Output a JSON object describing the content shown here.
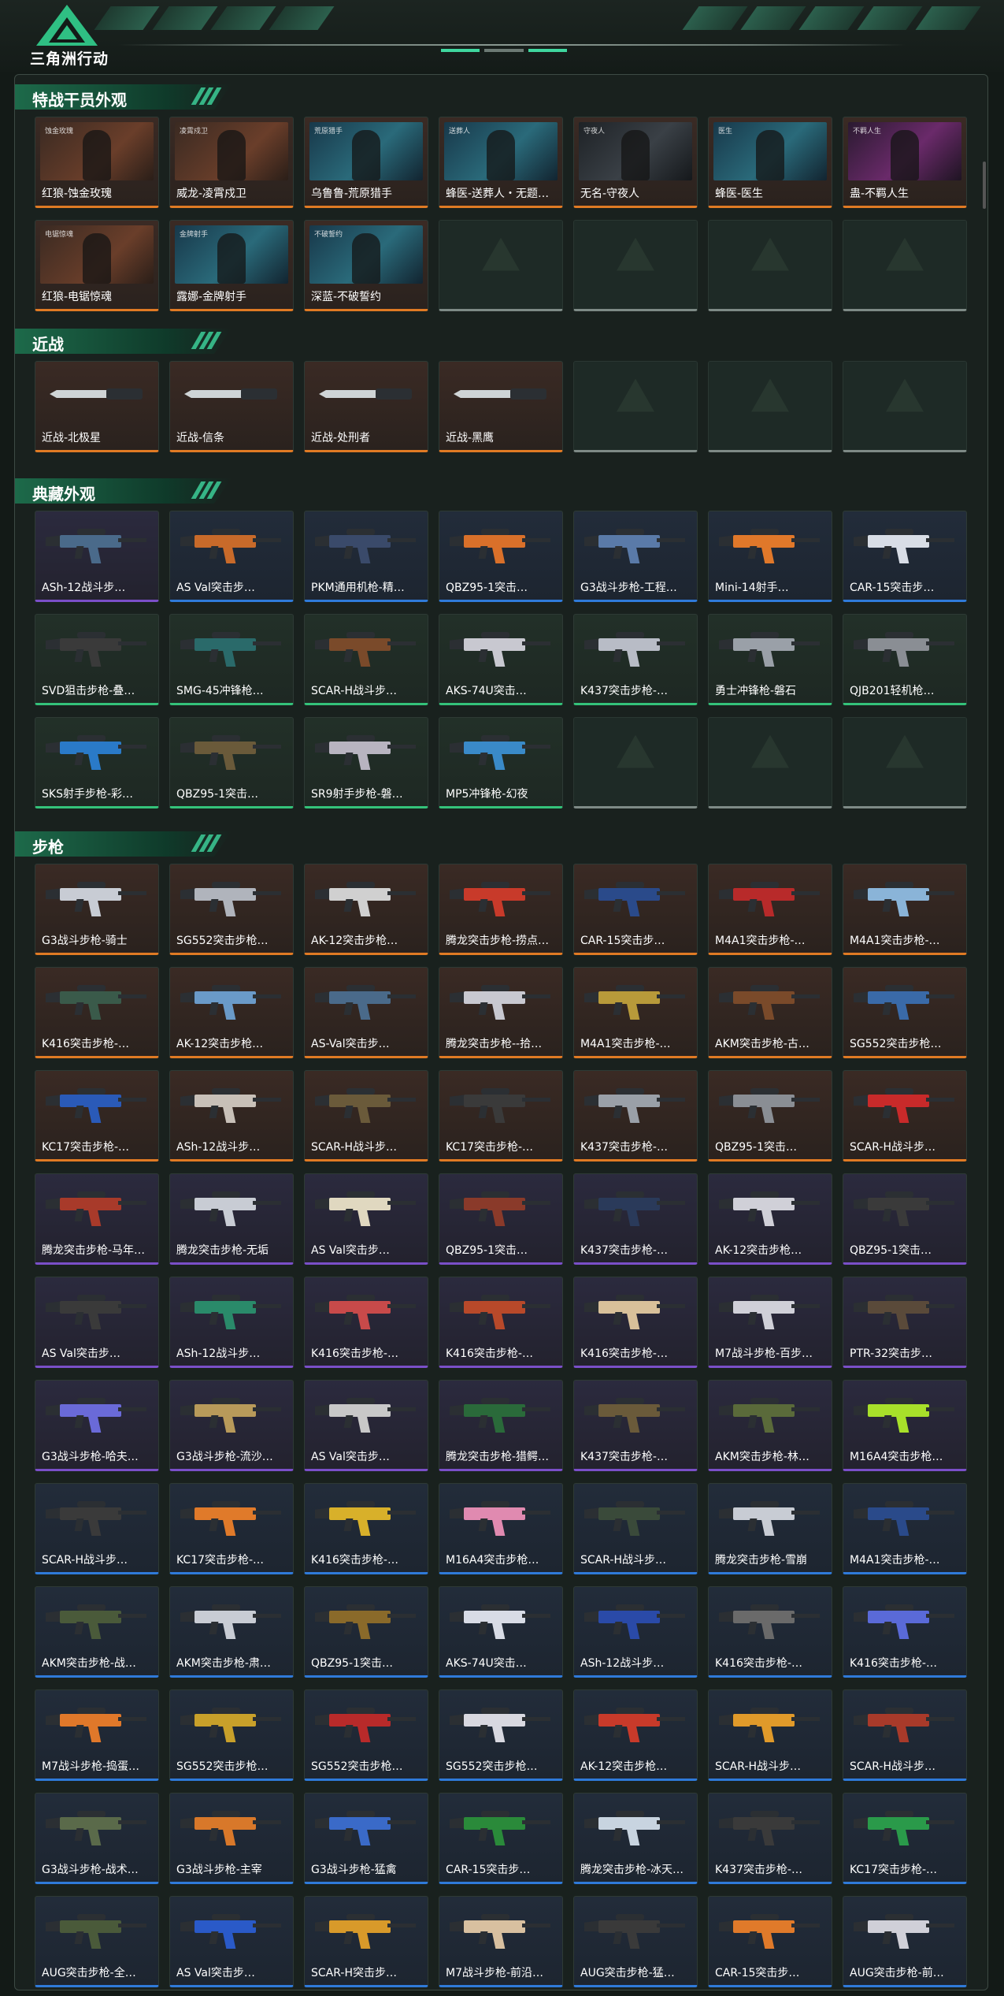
{
  "header": {
    "logo_text": "三角洲行动"
  },
  "sections": [
    {
      "title": "特战干员外观",
      "cards": [
        {
          "label": "红狼-蚀金玫瑰",
          "rarity": "orange",
          "tag": "蚀金玫瑰",
          "photo": "warm"
        },
        {
          "label": "威龙-凌霄戍卫",
          "rarity": "orange",
          "tag": "凌霄戍卫",
          "photo": "warm"
        },
        {
          "label": "乌鲁鲁-荒原猎手",
          "rarity": "orange",
          "tag": "荒原猎手",
          "photo": "teal"
        },
        {
          "label": "蜂医-送葬人・无题…",
          "rarity": "orange",
          "tag": "送葬人",
          "photo": "teal"
        },
        {
          "label": "无名-守夜人",
          "rarity": "orange",
          "tag": "守夜人",
          "photo": "dark"
        },
        {
          "label": "蜂医-医生",
          "rarity": "orange",
          "tag": "医生",
          "photo": "teal"
        },
        {
          "label": "蛊-不羁人生",
          "rarity": "orange",
          "tag": "不羁人生",
          "photo": "magenta"
        },
        {
          "label": "红狼-电锯惊魂",
          "rarity": "orange",
          "tag": "电锯惊魂",
          "photo": "warm"
        },
        {
          "label": "露娜-金牌射手",
          "rarity": "orange",
          "tag": "金牌射手",
          "photo": "teal"
        },
        {
          "label": "深蓝-不破誓约",
          "rarity": "orange",
          "tag": "不破誓约",
          "photo": "teal"
        },
        {
          "empty": true
        },
        {
          "empty": true
        },
        {
          "empty": true
        },
        {
          "empty": true
        }
      ]
    },
    {
      "title": "近战",
      "cards": [
        {
          "label": "近战-北极星",
          "rarity": "orange",
          "melee": true
        },
        {
          "label": "近战-信条",
          "rarity": "orange",
          "melee": true
        },
        {
          "label": "近战-处刑者",
          "rarity": "orange",
          "melee": true
        },
        {
          "label": "近战-黑鹰",
          "rarity": "orange",
          "melee": true
        },
        {
          "empty": true
        },
        {
          "empty": true
        },
        {
          "empty": true
        }
      ]
    },
    {
      "title": "典藏外观",
      "cards": [
        {
          "label": "ASh-12战斗步…",
          "rarity": "purple",
          "color": "#4a6a8a"
        },
        {
          "label": "AS Val突击步…",
          "rarity": "blue",
          "color": "#c86a2a"
        },
        {
          "label": "PKM通用机枪-精…",
          "rarity": "blue",
          "color": "#3a4a6a"
        },
        {
          "label": "QBZ95-1突击…",
          "rarity": "blue",
          "color": "#d9702a"
        },
        {
          "label": "G3战斗步枪-工程…",
          "rarity": "blue",
          "color": "#5a7aa8"
        },
        {
          "label": "Mini-14射手…",
          "rarity": "blue",
          "color": "#e0782a"
        },
        {
          "label": "CAR-15突击步…",
          "rarity": "blue",
          "color": "#d8dde6"
        },
        {
          "label": "SVD狙击步枪-叠…",
          "rarity": "green",
          "color": "#3a3a3a"
        },
        {
          "label": "SMG-45冲锋枪…",
          "rarity": "green",
          "color": "#2a6a6a"
        },
        {
          "label": "SCAR-H战斗步…",
          "rarity": "green",
          "color": "#7a4a2a"
        },
        {
          "label": "AKS-74U突击…",
          "rarity": "green",
          "color": "#c8c8d0"
        },
        {
          "label": "K437突击步枪-…",
          "rarity": "green",
          "color": "#b8bcc6"
        },
        {
          "label": "勇士冲锋枪-磐石",
          "rarity": "green",
          "color": "#9aa0a8"
        },
        {
          "label": "QJB201轻机枪…",
          "rarity": "green",
          "color": "#8a8e94"
        },
        {
          "label": "SKS射手步枪-彩…",
          "rarity": "green",
          "color": "#2a7ac8"
        },
        {
          "label": "QBZ95-1突击…",
          "rarity": "green",
          "color": "#6a5a3a"
        },
        {
          "label": "SR9射手步枪-磐…",
          "rarity": "green",
          "color": "#b8b4c0"
        },
        {
          "label": "MP5冲锋枪-幻夜",
          "rarity": "green",
          "color": "#3a8ac8"
        },
        {
          "empty": true
        },
        {
          "empty": true
        },
        {
          "empty": true
        }
      ]
    },
    {
      "title": "步枪",
      "cards": [
        {
          "label": "G3战斗步枪-骑士",
          "rarity": "orange",
          "color": "#c8ccd4"
        },
        {
          "label": "SG552突击步枪…",
          "rarity": "orange",
          "color": "#b0b4bc"
        },
        {
          "label": "AK-12突击步枪…",
          "rarity": "orange",
          "color": "#d0d0d0"
        },
        {
          "label": "腾龙突击步枪-捞点…",
          "rarity": "orange",
          "color": "#c83a2a"
        },
        {
          "label": "CAR-15突击步…",
          "rarity": "orange",
          "color": "#2a4a8a"
        },
        {
          "label": "M4A1突击步枪-…",
          "rarity": "orange",
          "color": "#b82a2a"
        },
        {
          "label": "M4A1突击步枪-…",
          "rarity": "orange",
          "color": "#8ab4d8"
        },
        {
          "label": "K416突击步枪-…",
          "rarity": "orange",
          "color": "#3a5a4a"
        },
        {
          "label": "AK-12突击步枪…",
          "rarity": "orange",
          "color": "#6a9ac8"
        },
        {
          "label": "AS-Val突击步…",
          "rarity": "orange",
          "color": "#4a6a8a"
        },
        {
          "label": "腾龙突击步枪--拾…",
          "rarity": "orange",
          "color": "#c8c8d0"
        },
        {
          "label": "M4A1突击步枪-…",
          "rarity": "orange",
          "color": "#b89a3a"
        },
        {
          "label": "AKM突击步枪-古…",
          "rarity": "orange",
          "color": "#7a4a2a"
        },
        {
          "label": "SG552突击步枪…",
          "rarity": "orange",
          "color": "#3a6aa8"
        },
        {
          "label": "KC17突击步枪-…",
          "rarity": "orange",
          "color": "#2a5ab8"
        },
        {
          "label": "ASh-12战斗步…",
          "rarity": "orange",
          "color": "#c8c0b8"
        },
        {
          "label": "SCAR-H战斗步…",
          "rarity": "orange",
          "color": "#6a5a3a"
        },
        {
          "label": "KC17突击步枪-…",
          "rarity": "orange",
          "color": "#3a3a3a"
        },
        {
          "label": "K437突击步枪-…",
          "rarity": "orange",
          "color": "#9aa0a8"
        },
        {
          "label": "QBZ95-1突击…",
          "rarity": "orange",
          "color": "#8a8e94"
        },
        {
          "label": "SCAR-H战斗步…",
          "rarity": "orange",
          "color": "#c82a2a"
        },
        {
          "label": "腾龙突击步枪-马年…",
          "rarity": "purple",
          "color": "#a83a2a"
        },
        {
          "label": "腾龙突击步枪-无垢",
          "rarity": "purple",
          "color": "#c8ccd4"
        },
        {
          "label": "AS Val突击步…",
          "rarity": "purple",
          "color": "#e0d8c0"
        },
        {
          "label": "QBZ95-1突击…",
          "rarity": "purple",
          "color": "#8a3a2a"
        },
        {
          "label": "K437突击步枪-…",
          "rarity": "purple",
          "color": "#2a3a5a"
        },
        {
          "label": "AK-12突击步枪…",
          "rarity": "purple",
          "color": "#d0d0d8"
        },
        {
          "label": "QBZ95-1突击…",
          "rarity": "purple",
          "color": "#3a3a3a"
        },
        {
          "label": "AS Val突击步…",
          "rarity": "purple",
          "color": "#3a3a3a"
        },
        {
          "label": "ASh-12战斗步…",
          "rarity": "purple",
          "color": "#2a8a6a"
        },
        {
          "label": "K416突击步枪-…",
          "rarity": "purple",
          "color": "#c84a4a"
        },
        {
          "label": "K416突击步枪-…",
          "rarity": "purple",
          "color": "#b8492a"
        },
        {
          "label": "K416突击步枪-…",
          "rarity": "purple",
          "color": "#d8c09a"
        },
        {
          "label": "M7战斗步枪-百步…",
          "rarity": "purple",
          "color": "#d0d0d8"
        },
        {
          "label": "PTR-32突击步…",
          "rarity": "purple",
          "color": "#5a4a3a"
        },
        {
          "label": "G3战斗步枪-哈夫…",
          "rarity": "purple",
          "color": "#6a6ad8"
        },
        {
          "label": "G3战斗步枪-流沙…",
          "rarity": "purple",
          "color": "#b89a5a"
        },
        {
          "label": "AS Val突击步…",
          "rarity": "purple",
          "color": "#c8c8c8"
        },
        {
          "label": "腾龙突击步枪-猎鳄…",
          "rarity": "purple",
          "color": "#2a6a3a"
        },
        {
          "label": "K437突击步枪-…",
          "rarity": "purple",
          "color": "#6a5a3a"
        },
        {
          "label": "AKM突击步枪-林…",
          "rarity": "purple",
          "color": "#5a6a3a"
        },
        {
          "label": "M16A4突击步枪…",
          "rarity": "purple",
          "color": "#a8e02a"
        },
        {
          "label": "SCAR-H战斗步…",
          "rarity": "blue",
          "color": "#3a3a3a"
        },
        {
          "label": "KC17突击步枪-…",
          "rarity": "blue",
          "color": "#e07a2a"
        },
        {
          "label": "K416突击步枪-…",
          "rarity": "blue",
          "color": "#d8b02a"
        },
        {
          "label": "M16A4突击步枪…",
          "rarity": "blue",
          "color": "#e08ab0"
        },
        {
          "label": "SCAR-H战斗步…",
          "rarity": "blue",
          "color": "#3a4a3a"
        },
        {
          "label": "腾龙突击步枪-雪崩",
          "rarity": "blue",
          "color": "#c8ccd4"
        },
        {
          "label": "M4A1突击步枪-…",
          "rarity": "blue",
          "color": "#2a4a8a"
        },
        {
          "label": "AKM突击步枪-战…",
          "rarity": "blue",
          "color": "#4a5a3a"
        },
        {
          "label": "AKM突击步枪-肃…",
          "rarity": "blue",
          "color": "#c8ccd4"
        },
        {
          "label": "QBZ95-1突击…",
          "rarity": "blue",
          "color": "#8a6a2a"
        },
        {
          "label": "AKS-74U突击…",
          "rarity": "blue",
          "color": "#d8dce6"
        },
        {
          "label": "ASh-12战斗步…",
          "rarity": "blue",
          "color": "#2a4aa8"
        },
        {
          "label": "K416突击步枪-…",
          "rarity": "blue",
          "color": "#6a6a6a"
        },
        {
          "label": "K416突击步枪-…",
          "rarity": "blue",
          "color": "#5a6ad8"
        },
        {
          "label": "M7战斗步枪-捣蛋…",
          "rarity": "blue",
          "color": "#e0782a"
        },
        {
          "label": "SG552突击步枪…",
          "rarity": "blue",
          "color": "#c8a02a"
        },
        {
          "label": "SG552突击步枪…",
          "rarity": "blue",
          "color": "#b82a2a"
        },
        {
          "label": "SG552突击步枪…",
          "rarity": "blue",
          "color": "#d8d8e0"
        },
        {
          "label": "AK-12突击步枪…",
          "rarity": "blue",
          "color": "#c83a2a"
        },
        {
          "label": "SCAR-H战斗步…",
          "rarity": "blue",
          "color": "#e09a2a"
        },
        {
          "label": "SCAR-H战斗步…",
          "rarity": "blue",
          "color": "#a83a2a"
        },
        {
          "label": "G3战斗步枪-战术…",
          "rarity": "blue",
          "color": "#5a6a4a"
        },
        {
          "label": "G3战斗步枪-主宰",
          "rarity": "blue",
          "color": "#d8782a"
        },
        {
          "label": "G3战斗步枪-猛禽",
          "rarity": "blue",
          "color": "#3a6ac8"
        },
        {
          "label": "CAR-15突击步…",
          "rarity": "blue",
          "color": "#2a8a3a"
        },
        {
          "label": "腾龙突击步枪-冰天…",
          "rarity": "blue",
          "color": "#c8d4e0"
        },
        {
          "label": "K437突击步枪-…",
          "rarity": "blue",
          "color": "#3a3a3a"
        },
        {
          "label": "KC17突击步枪-…",
          "rarity": "blue",
          "color": "#2a9a4a"
        },
        {
          "label": "AUG突击步枪-全…",
          "rarity": "blue",
          "color": "#4a5a3a"
        },
        {
          "label": "AS Val突击步…",
          "rarity": "blue",
          "color": "#2a5ac8"
        },
        {
          "label": "SCAR-H突击步…",
          "rarity": "blue",
          "color": "#d89a2a"
        },
        {
          "label": "M7战斗步枪-前沿…",
          "rarity": "blue",
          "color": "#d8c0a0"
        },
        {
          "label": "AUG突击步枪-猛…",
          "rarity": "blue",
          "color": "#3a3a3a"
        },
        {
          "label": "CAR-15突击步…",
          "rarity": "blue",
          "color": "#e07a2a"
        },
        {
          "label": "AUG突击步枪-前…",
          "rarity": "blue",
          "color": "#d0d0d8"
        }
      ]
    }
  ]
}
